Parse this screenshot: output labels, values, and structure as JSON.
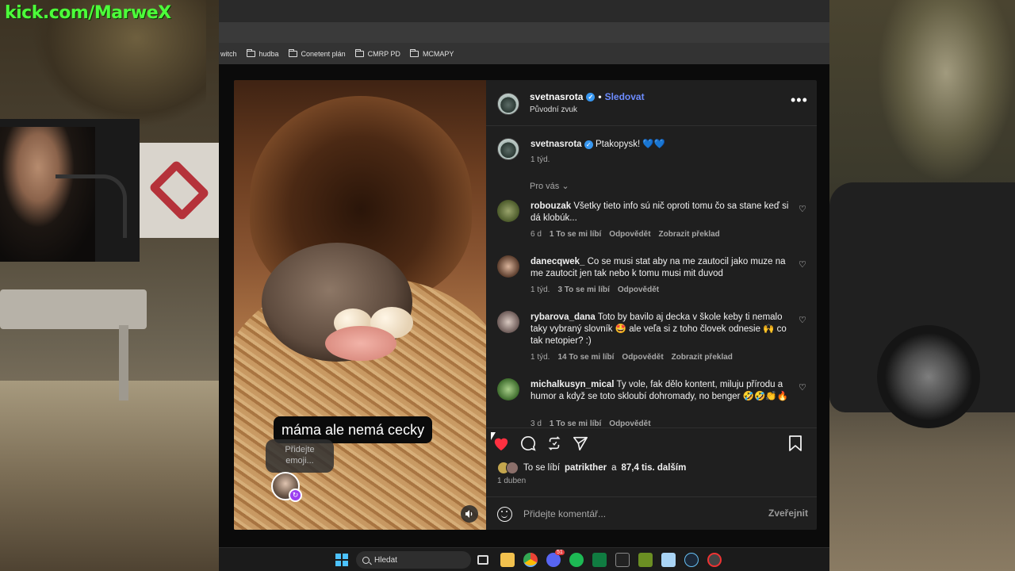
{
  "overlay": {
    "streamer_url": "kick.com/MarweX"
  },
  "browser": {
    "bookmarks": [
      {
        "label": "witch",
        "folder": false
      },
      {
        "label": "hudba",
        "folder": true
      },
      {
        "label": "Conetent plán",
        "folder": true
      },
      {
        "label": "CMRP PD",
        "folder": true
      },
      {
        "label": "MCMAPY",
        "folder": true
      }
    ]
  },
  "video": {
    "caption": "máma ale nemá cecky",
    "emoji_prompt_line1": "Přidejte",
    "emoji_prompt_line2": "emoji..."
  },
  "post": {
    "author": "svetnasrota",
    "separator": "•",
    "follow_label": "Sledovat",
    "audio": "Původní zvuk",
    "more_label": "•••",
    "caption_text": "Ptakopysk! 💙💙",
    "caption_time": "1 týd.",
    "filter_label": "Pro vás",
    "comments": [
      {
        "user": "robouzak",
        "text": "Všetky tieto info sú nič oproti tomu čo sa stane keď si dá klobúk...",
        "time": "6 d",
        "likes": "1 To se mi líbí",
        "reply": "Odpovědět",
        "translate": "Zobrazit překlad"
      },
      {
        "user": "danecqwek_",
        "text": "Co se musi stat aby na me zautocil jako muze na me zautocit jen tak nebo k tomu musi mit duvod",
        "time": "1 týd.",
        "likes": "3 To se mi líbí",
        "reply": "Odpovědět",
        "translate": ""
      },
      {
        "user": "rybarova_dana",
        "text": "Toto by bavilo aj decka v škole keby ti nemalo taky vybraný slovník 🤩 ale veľa si z toho človek odnesie 🙌 co tak netopier? :)",
        "time": "1 týd.",
        "likes": "14 To se mi líbí",
        "reply": "Odpovědět",
        "translate": "Zobrazit překlad"
      },
      {
        "user": "michalkusyn_mical",
        "text": "Ty vole, fak dělo kontent, miluju přírodu a humor a když se toto skloubí dohromady, no benger 🤣🤣👏🔥",
        "time": "3 d",
        "likes": "1 To se mi líbí",
        "reply": "Odpovědět",
        "translate": ""
      }
    ],
    "likes_prefix": "To se líbí",
    "likes_user": "patrikther",
    "likes_and": "a",
    "likes_rest": "87,4 tis. dalším",
    "date": "1 duben",
    "comment_placeholder": "Přidejte komentář...",
    "post_button": "Zveřejnit"
  },
  "taskbar": {
    "search_label": "Hledat",
    "discord_badge": "51"
  },
  "colors": {
    "accent_follow": "#6d8cff",
    "like_red": "#ff3040",
    "verified_blue": "#3897f0",
    "streamer_green": "#4cff3a"
  }
}
